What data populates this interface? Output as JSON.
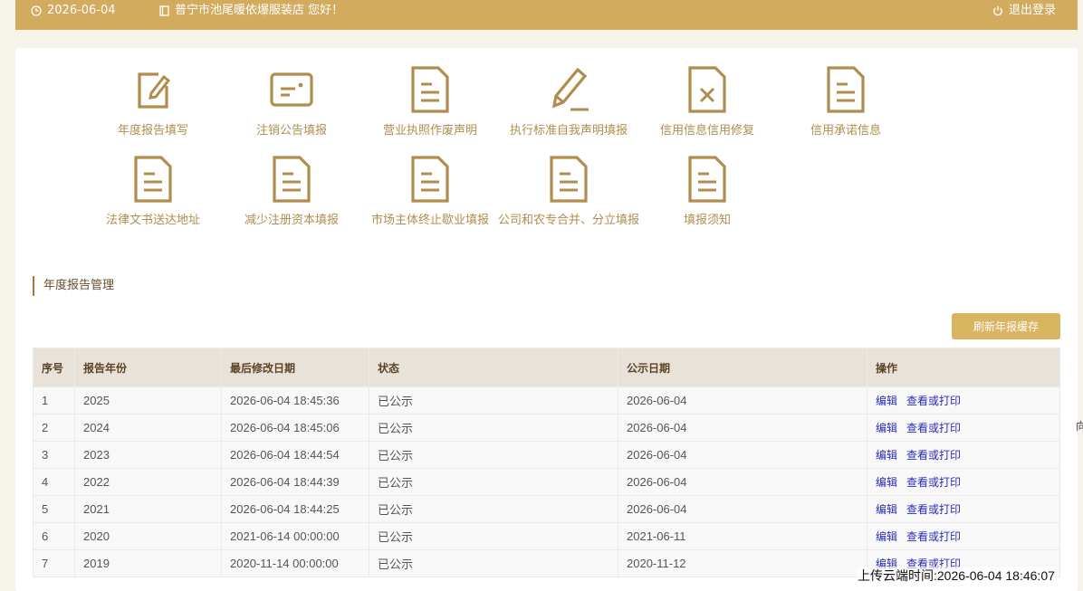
{
  "header": {
    "date": "2026-06-04",
    "store_greeting": "普宁市池尾暖依爆服装店 您好！",
    "logout_label": "退出登录"
  },
  "tiles": [
    {
      "label": "年度报告填写",
      "icon": "edit-icon"
    },
    {
      "label": "注销公告填报",
      "icon": "card-icon"
    },
    {
      "label": "营业执照作废声明",
      "icon": "document-icon"
    },
    {
      "label": "执行标准自我声明填报",
      "icon": "pencil-icon"
    },
    {
      "label": "信用信息信用修复",
      "icon": "document-x-icon"
    },
    {
      "label": "信用承诺信息",
      "icon": "document-icon"
    },
    {
      "label": "法律文书送达地址",
      "icon": "document-icon"
    },
    {
      "label": "减少注册资本填报",
      "icon": "document-icon"
    },
    {
      "label": "市场主体终止歇业填报",
      "icon": "document-icon"
    },
    {
      "label": "公司和农专合并、分立填报",
      "icon": "document-icon"
    },
    {
      "label": "填报须知",
      "icon": "document-icon"
    }
  ],
  "section": {
    "title": "年度报告管理",
    "refresh_label": "刷新年报缓存"
  },
  "table": {
    "headers": [
      "序号",
      "报告年份",
      "最后修改日期",
      "状态",
      "公示日期",
      "操作"
    ],
    "rows": [
      {
        "no": "1",
        "year": "2025",
        "modified": "2026-06-04 18:45:36",
        "status": "已公示",
        "public_date": "2026-06-04",
        "edit": "编辑",
        "view": "查看或打印"
      },
      {
        "no": "2",
        "year": "2024",
        "modified": "2026-06-04 18:45:06",
        "status": "已公示",
        "public_date": "2026-06-04",
        "edit": "编辑",
        "view": "查看或打印"
      },
      {
        "no": "3",
        "year": "2023",
        "modified": "2026-06-04 18:44:54",
        "status": "已公示",
        "public_date": "2026-06-04",
        "edit": "编辑",
        "view": "查看或打印"
      },
      {
        "no": "4",
        "year": "2022",
        "modified": "2026-06-04 18:44:39",
        "status": "已公示",
        "public_date": "2026-06-04",
        "edit": "编辑",
        "view": "查看或打印"
      },
      {
        "no": "5",
        "year": "2021",
        "modified": "2026-06-04 18:44:25",
        "status": "已公示",
        "public_date": "2026-06-04",
        "edit": "编辑",
        "view": "查看或打印"
      },
      {
        "no": "6",
        "year": "2020",
        "modified": "2021-06-14 00:00:00",
        "status": "已公示",
        "public_date": "2021-06-11",
        "edit": "编辑",
        "view": "查看或打印"
      },
      {
        "no": "7",
        "year": "2019",
        "modified": "2020-11-14 00:00:00",
        "status": "已公示",
        "public_date": "2020-11-12",
        "edit": "编辑",
        "view": "查看或打印"
      }
    ]
  },
  "watermark": "上传云端时间:2026-06-04 18:46:07",
  "edge_char": "向",
  "colors": {
    "header_bg": "#d2ab5e",
    "icon_gold": "#b08d4f",
    "button_bg": "#d8b560",
    "table_header_bg": "#e9e2d8",
    "link_blue": "#2b2bbd"
  }
}
